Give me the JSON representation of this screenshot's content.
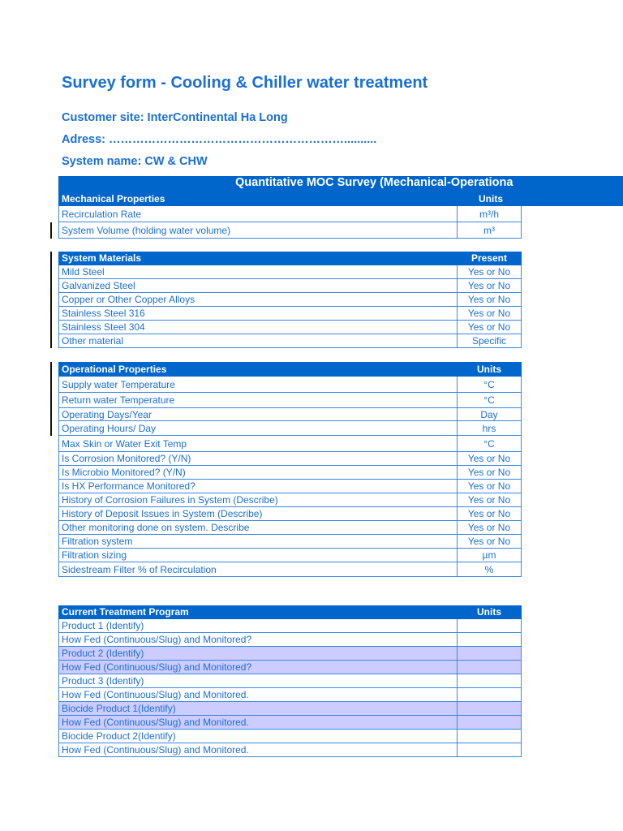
{
  "title": "Survey form - Cooling & Chiller water treatment",
  "customer_site": "Customer site: InterContinental Ha Long",
  "address": "Adress: ……………………………………………………..........",
  "system_name": "System name: CW & CHW",
  "banner": "Quantitative MOC Survey (Mechanical-Operationa",
  "sections": [
    {
      "header": [
        "Mechanical Properties",
        "Units"
      ],
      "rows": [
        [
          "Recirculation Rate",
          "m³/h"
        ],
        [
          "System Volume (holding water volume)",
          "m³"
        ]
      ]
    },
    {
      "header": [
        "System Materials",
        "Present"
      ],
      "rows": [
        [
          "Mild Steel",
          "Yes or No"
        ],
        [
          "Galvanized Steel",
          "Yes or No"
        ],
        [
          "Copper or Other Copper Alloys",
          "Yes or No"
        ],
        [
          "Stainless Steel 316",
          "Yes or No"
        ],
        [
          "Stainless Steel 304",
          "Yes or No"
        ],
        [
          "Other material",
          "Specific"
        ]
      ]
    },
    {
      "header": [
        "Operational Properties",
        "Units"
      ],
      "rows": [
        [
          "Supply water Temperature",
          "°C"
        ],
        [
          "Return water Temperature",
          "°C"
        ],
        [
          "Operating Days/Year",
          "Day"
        ],
        [
          "Operating Hours/ Day",
          "hrs"
        ],
        [
          "Max Skin or Water Exit Temp",
          "°C"
        ],
        [
          "Is Corrosion Monitored? (Y/N)",
          "Yes or No"
        ],
        [
          "Is Microbio Monitored? (Y/N)",
          "Yes or No"
        ],
        [
          "Is HX Performance Monitored?",
          "Yes or No"
        ],
        [
          "History of Corrosion Failures in System (Describe)",
          "Yes or No"
        ],
        [
          "History of Deposit Issues in System (Describe)",
          "Yes or No"
        ],
        [
          "Other monitoring done on system.  Describe",
          "Yes or No"
        ],
        [
          "Filtration system",
          "Yes or No"
        ],
        [
          "Filtration sizing",
          "µm"
        ],
        [
          "Sidestream Filter % of Recirculation",
          "%"
        ]
      ]
    },
    {
      "header": [
        "Current Treatment Program",
        "Units"
      ],
      "rows": [
        [
          "Product 1 (Identify)",
          ""
        ],
        [
          "How Fed (Continuous/Slug) and Monitored?",
          ""
        ],
        [
          "Product 2 (Identify)",
          ""
        ],
        [
          "How Fed (Continuous/Slug) and Monitored?",
          ""
        ],
        [
          "Product 3 (Identify)",
          ""
        ],
        [
          "How Fed (Continuous/Slug) and Monitored.",
          ""
        ],
        [
          "Biocide Product 1(Identify)",
          ""
        ],
        [
          "How Fed (Continuous/Slug) and Monitored.",
          ""
        ],
        [
          "Biocide Product 2(Identify)",
          ""
        ],
        [
          "How Fed (Continuous/Slug) and Monitored.",
          ""
        ]
      ]
    }
  ]
}
